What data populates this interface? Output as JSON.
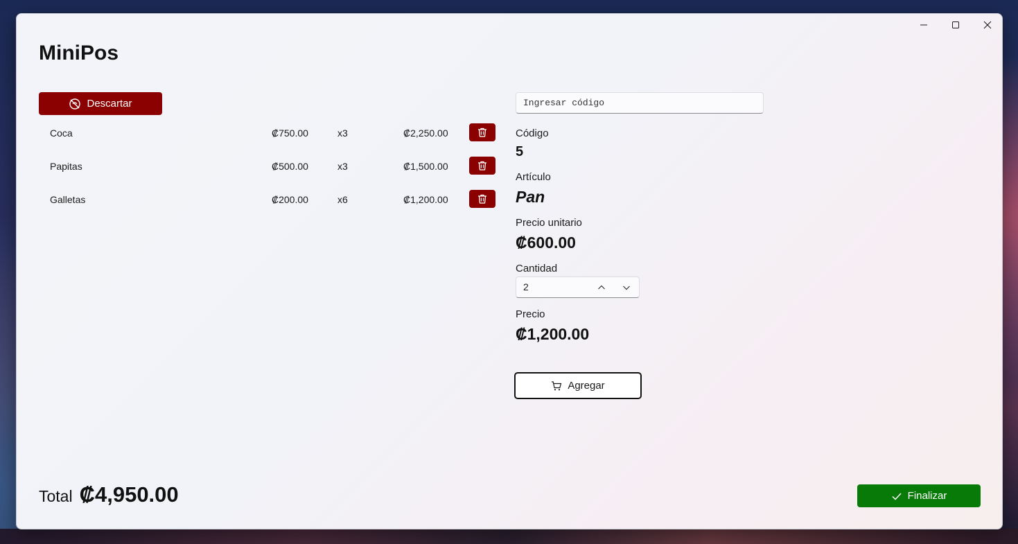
{
  "app": {
    "title": "MiniPos"
  },
  "colors": {
    "danger": "#8b0000",
    "success": "#087a08"
  },
  "toolbar": {
    "discard_label": "Descartar",
    "discard_icon": "discard-icon"
  },
  "cart": {
    "items": [
      {
        "name": "Coca",
        "unit_price": "₡750.00",
        "qty": "x3",
        "total": "₡2,250.00"
      },
      {
        "name": "Papitas",
        "unit_price": "₡500.00",
        "qty": "x3",
        "total": "₡1,500.00"
      },
      {
        "name": "Galletas",
        "unit_price": "₡200.00",
        "qty": "x6",
        "total": "₡1,200.00"
      }
    ],
    "delete_icon": "trash-icon"
  },
  "form": {
    "code_placeholder": "Ingresar código",
    "code_label": "Código",
    "code_value": "5",
    "item_label": "Artículo",
    "item_value": "Pan",
    "unit_price_label": "Precio unitario",
    "unit_price_value": "₡600.00",
    "quantity_label": "Cantidad",
    "quantity_value": "2",
    "price_label": "Precio",
    "price_value": "₡1,200.00",
    "add_label": "Agregar",
    "add_icon": "cart-icon"
  },
  "footer": {
    "total_label": "Total",
    "total_value": "₡4,950.00",
    "finish_label": "Finalizar",
    "finish_icon": "check-icon"
  }
}
